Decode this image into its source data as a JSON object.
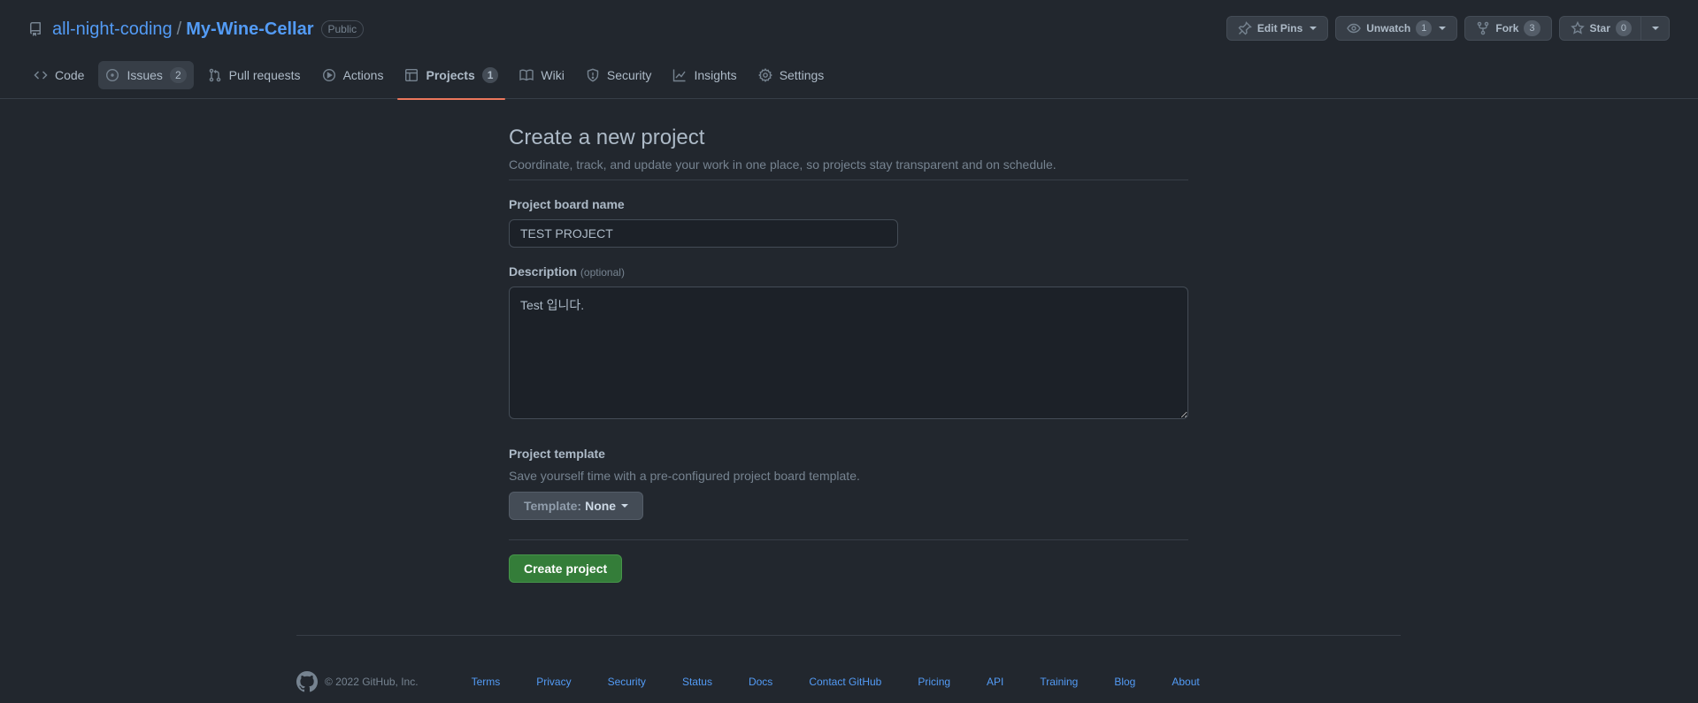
{
  "repo": {
    "owner": "all-night-coding",
    "separator": "/",
    "name": "My-Wine-Cellar",
    "visibility": "Public"
  },
  "actions": {
    "edit_pins": "Edit Pins",
    "unwatch": "Unwatch",
    "unwatch_count": "1",
    "fork": "Fork",
    "fork_count": "3",
    "star": "Star",
    "star_count": "0"
  },
  "nav": {
    "code": "Code",
    "issues": "Issues",
    "issues_count": "2",
    "pulls": "Pull requests",
    "actions": "Actions",
    "projects": "Projects",
    "projects_count": "1",
    "wiki": "Wiki",
    "security": "Security",
    "insights": "Insights",
    "settings": "Settings"
  },
  "form": {
    "title": "Create a new project",
    "subtitle": "Coordinate, track, and update your work in one place, so projects stay transparent and on schedule.",
    "name_label": "Project board name",
    "name_value": "TEST PROJECT",
    "description_label": "Description",
    "description_optional": "(optional)",
    "description_value": "Test 입니다.",
    "template_title": "Project template",
    "template_note": "Save yourself time with a pre-configured project board template.",
    "template_prefix": "Template:",
    "template_value": "None",
    "submit": "Create project"
  },
  "footer": {
    "copyright": "© 2022 GitHub, Inc.",
    "links": [
      "Terms",
      "Privacy",
      "Security",
      "Status",
      "Docs",
      "Contact GitHub",
      "Pricing",
      "API",
      "Training",
      "Blog",
      "About"
    ]
  },
  "colors": {
    "background": "#22272e",
    "link": "#539bf5",
    "selected_tab_underline": "#ec775c",
    "primary_button": "#347d39"
  }
}
